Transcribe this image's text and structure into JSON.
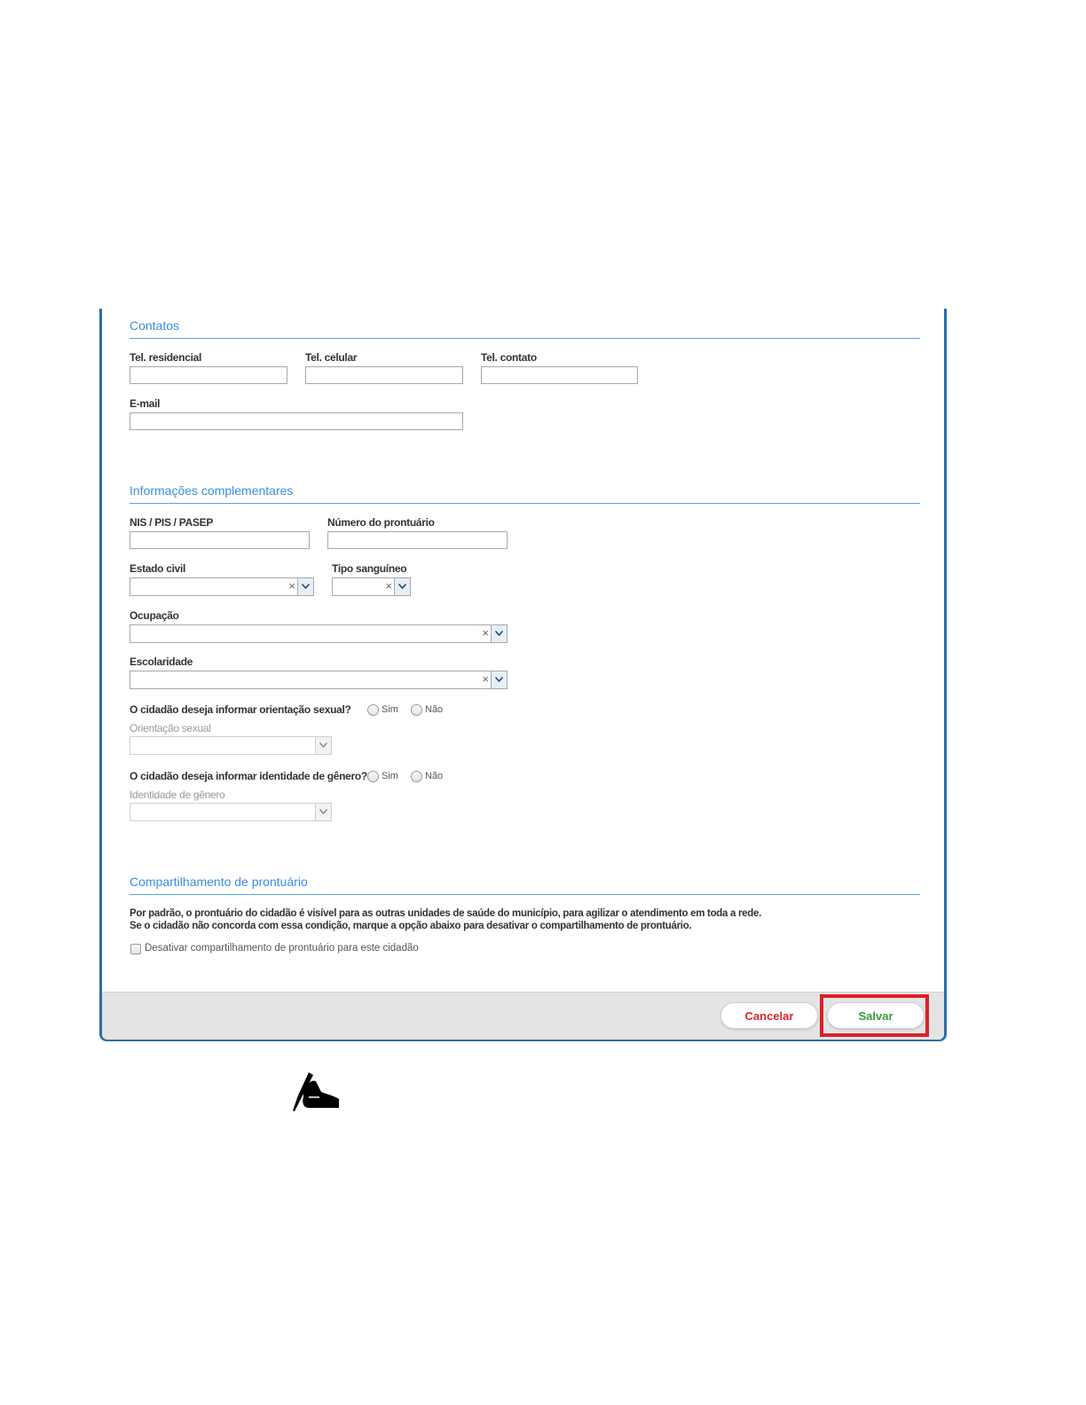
{
  "contatos": {
    "title": "Contatos",
    "tel_residencial": "Tel. residencial",
    "tel_celular": "Tel. celular",
    "tel_contato": "Tel. contato",
    "email": "E-mail"
  },
  "complementares": {
    "title": "Informações complementares",
    "nis": "NIS / PIS / PASEP",
    "prontuario": "Número do prontuário",
    "estado_civil": "Estado civil",
    "tipo_sanguineo": "Tipo sanguíneo",
    "ocupacao": "Ocupação",
    "escolaridade": "Escolaridade",
    "orientacao_question": "O cidadão deseja informar orientação sexual?",
    "orientacao_label": "Orientação sexual",
    "identidade_question": "O cidadão deseja informar identidade de gênero?",
    "identidade_label": "Identidade de gênero",
    "sim": "Sim",
    "nao": "Não",
    "clear_glyph": "×"
  },
  "compartilhamento": {
    "title": "Compartilhamento de prontuário",
    "line1": "Por padrão, o prontuário do cidadão é visível para as outras unidades de saúde do município, para agilizar o atendimento em toda a rede.",
    "line2": "Se o cidadão não concorda com essa condição, marque a opção abaixo para desativar o compartilhamento de prontuário.",
    "checkbox_label": "Desativar compartilhamento de prontuário para este cidadão"
  },
  "footer": {
    "cancel": "Cancelar",
    "save": "Salvar"
  },
  "colors": {
    "section_title": "#3a8de0",
    "cancel_text": "#d9262e",
    "save_text": "#3a9a3a",
    "highlight": "#e01e27",
    "panel_border": "#2e6da4"
  },
  "icons": {
    "note": "writing-hand-icon"
  }
}
